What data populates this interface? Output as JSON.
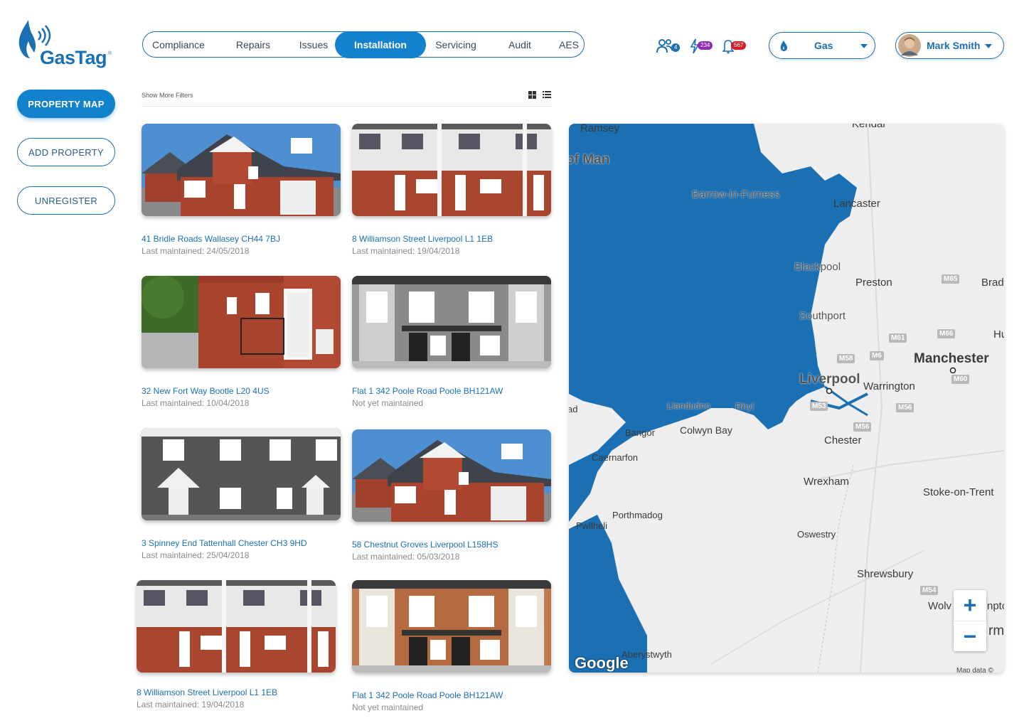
{
  "brand": {
    "name": "GasTag",
    "tm": "®"
  },
  "sidebar": {
    "buttons": [
      {
        "label": "PROPERTY MAP"
      },
      {
        "label": "ADD PROPERTY"
      },
      {
        "label": "UNREGISTER"
      }
    ]
  },
  "tabs": [
    {
      "label": "Compliance"
    },
    {
      "label": "Repairs"
    },
    {
      "label": "Issues"
    },
    {
      "label": "Installation",
      "active": true
    },
    {
      "label": "Servicing"
    },
    {
      "label": "Audit"
    },
    {
      "label": "AES"
    }
  ],
  "header": {
    "users_badge": "4",
    "alerts_badge": "234",
    "notifications_badge": "567",
    "fuel_select": "Gas",
    "user_name": "Mark Smith"
  },
  "filters": {
    "show_more": "Show More Filters"
  },
  "properties": [
    {
      "address": "41 Bridle Roads Wallasey CH44 7BJ",
      "maintained": "Last maintained: 24/05/2018"
    },
    {
      "address": "8 Williamson Street Liverpool L1 1EB",
      "maintained": "Last maintained: 19/04/2018"
    },
    {
      "address": "32 New Fort Way Bootle L20 4US",
      "maintained": "Last maintained: 10/04/2018"
    },
    {
      "address": "Flat 1 342 Poole Road Poole BH121AW",
      "maintained": "Not yet maintained"
    },
    {
      "address": "3 Spinney End Tattenhall Chester CH3 9HD",
      "maintained": "Last maintained: 25/04/2018"
    },
    {
      "address": "58 Chestnut Groves Liverpool L158HS",
      "maintained": "Last maintained: 05/03/2018"
    },
    {
      "address": "8 Williamson Street Liverpool L1 1EB",
      "maintained": "Last maintained: 19/04/2018"
    },
    {
      "address": "Flat 1 342 Poole Road Poole BH121AW",
      "maintained": "Not yet maintained"
    }
  ],
  "map": {
    "places": [
      "Ramsey",
      "of Man",
      "Kendal",
      "Barrow-in-Furness",
      "Lancaster",
      "Blackpool",
      "Preston",
      "Brad",
      "Southport",
      "Hu",
      "Manchester",
      "Liverpool",
      "Warrington",
      "Llandudno",
      "Rhyl",
      "ad",
      "Bangor",
      "Colwyn Bay",
      "Chester",
      "Caernarfon",
      "Wrexham",
      "Stoke-on-Trent",
      "Porthmadog",
      "Pwllheli",
      "Oswestry",
      "Shrewsbury",
      "Wolv",
      "npto",
      "rmi",
      "Aberystwyth"
    ],
    "motorways": [
      "M65",
      "M61",
      "M66",
      "M58",
      "M6",
      "M60",
      "M53",
      "M56",
      "M56",
      "M54"
    ],
    "attribution": "Google",
    "map_data": "Map data ©",
    "zoom_in": "+",
    "zoom_out": "−",
    "colors": {
      "sea": "#1b6fb3",
      "land": "#eeeeee"
    }
  }
}
